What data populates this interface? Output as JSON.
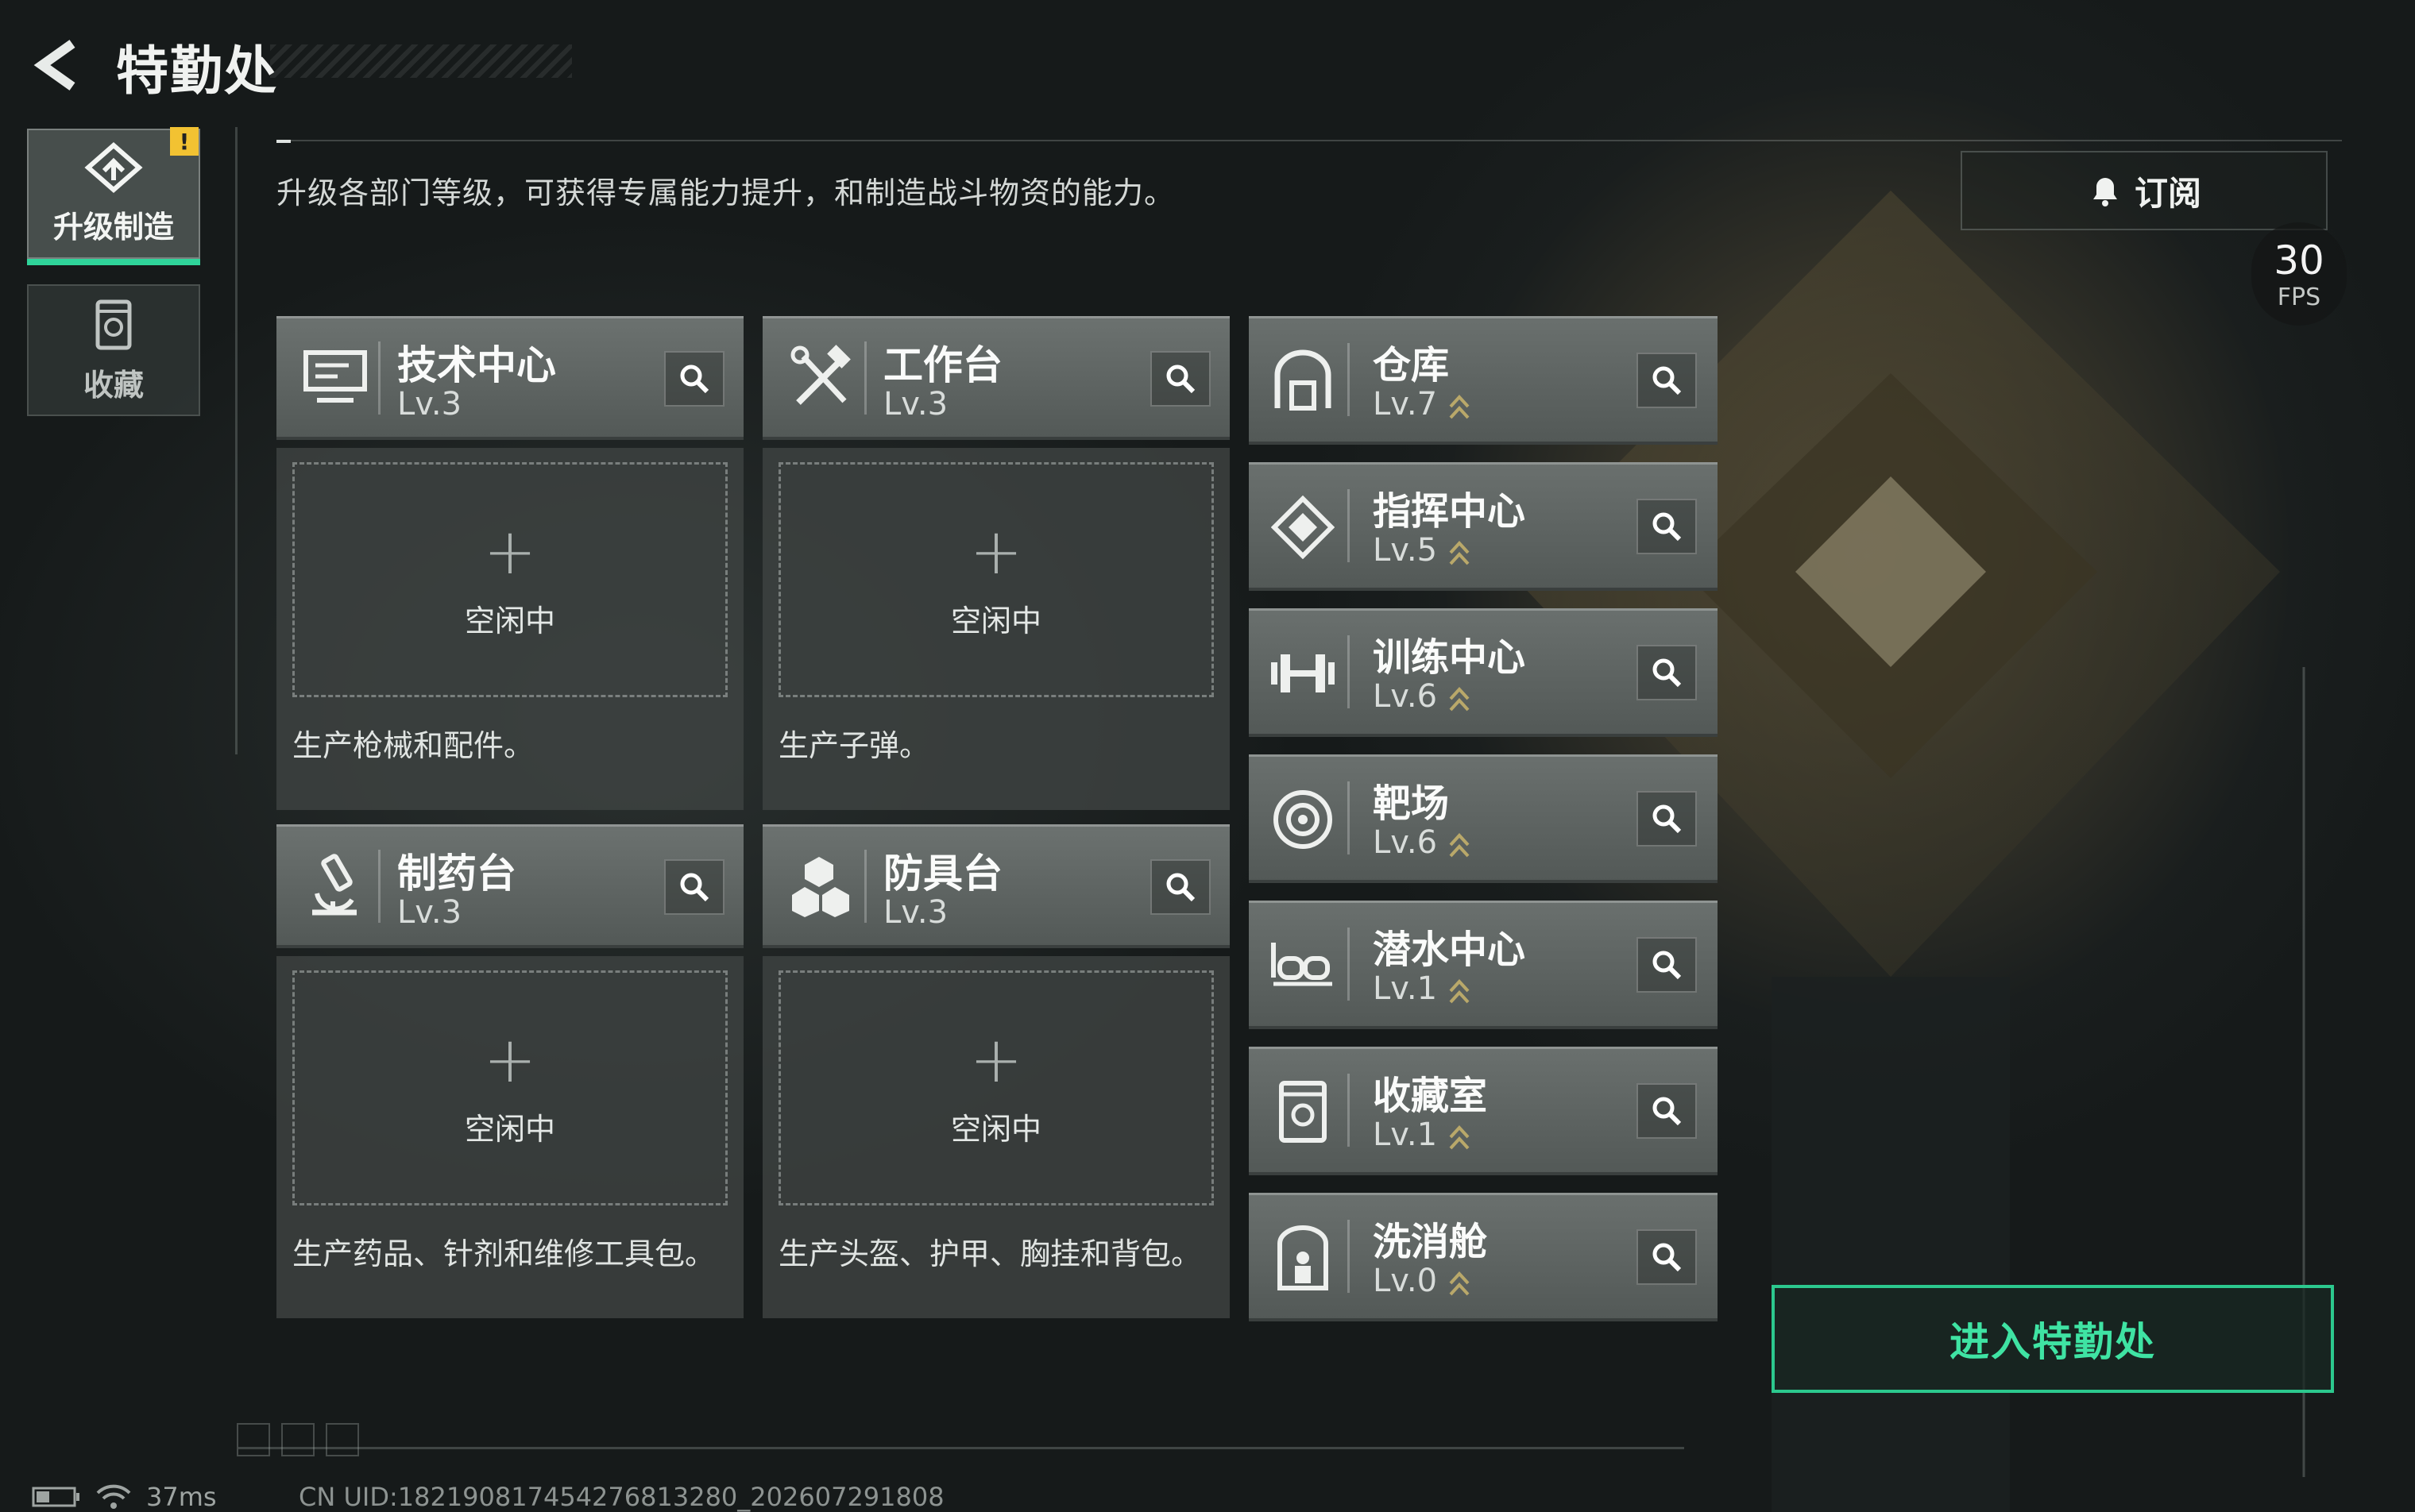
{
  "header": {
    "title": "特勤处"
  },
  "tabs": [
    {
      "label": "升级制造",
      "icon": "upgrade-icon",
      "active": true,
      "badge": "!"
    },
    {
      "label": "收藏",
      "icon": "collection-icon",
      "active": false
    }
  ],
  "description": "升级各部门等级，可获得专属能力提升，和制造战斗物资的能力。",
  "subscribe": {
    "label": "订阅",
    "icon": "bell-icon"
  },
  "fps": {
    "value": "30",
    "unit": "FPS"
  },
  "production": [
    {
      "name": "技术中心",
      "level": "Lv.3",
      "icon": "monitor-icon",
      "status": "空闲中",
      "plus": "+",
      "desc": "生产枪械和配件。"
    },
    {
      "name": "工作台",
      "level": "Lv.3",
      "icon": "tools-icon",
      "status": "空闲中",
      "plus": "+",
      "desc": "生产子弹。"
    },
    {
      "name": "制药台",
      "level": "Lv.3",
      "icon": "microscope-icon",
      "status": "空闲中",
      "plus": "+",
      "desc": "生产药品、针剂和维修工具包。"
    },
    {
      "name": "防具台",
      "level": "Lv.3",
      "icon": "armor-icon",
      "status": "空闲中",
      "plus": "+",
      "desc": "生产头盔、护甲、胸挂和背包。"
    }
  ],
  "facilities": [
    {
      "name": "仓库",
      "level": "Lv.7",
      "icon": "warehouse-icon"
    },
    {
      "name": "指挥中心",
      "level": "Lv.5",
      "icon": "command-icon"
    },
    {
      "name": "训练中心",
      "level": "Lv.6",
      "icon": "dumbbell-icon"
    },
    {
      "name": "靶场",
      "level": "Lv.6",
      "icon": "target-icon"
    },
    {
      "name": "潜水中心",
      "level": "Lv.1",
      "icon": "diving-mask-icon"
    },
    {
      "name": "收藏室",
      "level": "Lv.1",
      "icon": "collection-room-icon"
    },
    {
      "name": "洗消舱",
      "level": "Lv.0",
      "icon": "decon-icon"
    }
  ],
  "enter_button": "进入特勤处",
  "status_bar": {
    "ping": "37ms",
    "uid": "CN UID:1821908174542768132​80_202607291808"
  },
  "colors": {
    "accent": "#2cc88e",
    "accent_text": "#3fe3a3",
    "warning": "#f2c232",
    "upgrade_arrow": "#b9a86a"
  }
}
